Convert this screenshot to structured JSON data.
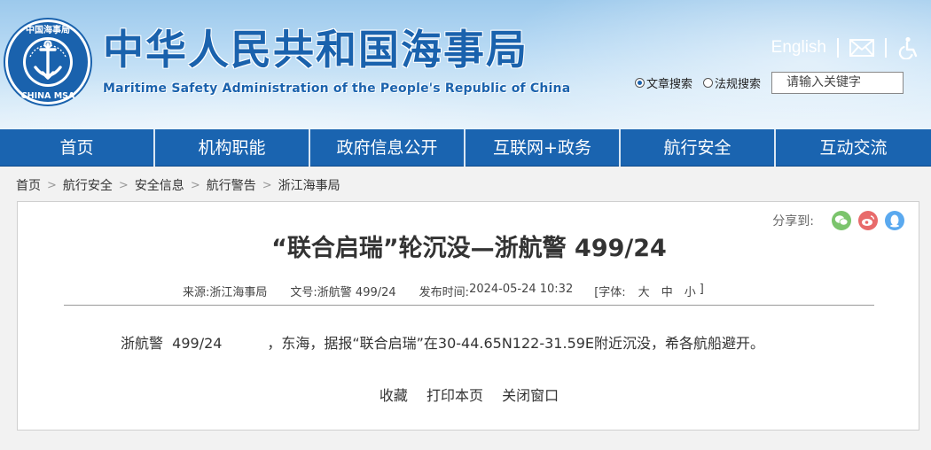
{
  "header": {
    "title": "中华人民共和国海事局",
    "subtitle": "Maritime Safety Administration of the People's Republic of China",
    "logo": {
      "top_text": "中国海事局",
      "bottom_text": "CHINA MSA"
    },
    "english_link": "English",
    "search": {
      "options": [
        "文章搜索",
        "法规搜索"
      ],
      "selected": "文章搜索",
      "placeholder": "请输入关键字"
    },
    "brand_color": "#1a62ad"
  },
  "nav": {
    "items": [
      "首页",
      "机构职能",
      "政府信息公开",
      "互联网+政务",
      "航行安全",
      "互动交流"
    ],
    "background": "#1a64b0"
  },
  "breadcrumb": [
    "首页",
    "航行安全",
    "安全信息",
    "航行警告",
    "浙江海事局"
  ],
  "article": {
    "share_label": "分享到:",
    "share_icons": [
      "wechat-icon",
      "weibo-icon",
      "qq-icon"
    ],
    "title": "“联合启瑞”轮沉没—浙航警 499/24",
    "meta": {
      "source_label": "来源:",
      "source": "浙江海事局",
      "number_label": "文号:",
      "number": "浙航警 499/24",
      "date_label": "发布时间:",
      "date": "2024-05-24 10:32",
      "font_label": "[字体:",
      "font_sizes": [
        "大",
        "中",
        "小"
      ],
      "font_close": "]"
    },
    "body": "浙航警  499/24          ，东海，据报“联合启瑞”在30-44.65N122-31.59E附近沉没，希各航船避开。",
    "actions": [
      "收藏",
      "打印本页",
      "关闭窗口"
    ]
  }
}
